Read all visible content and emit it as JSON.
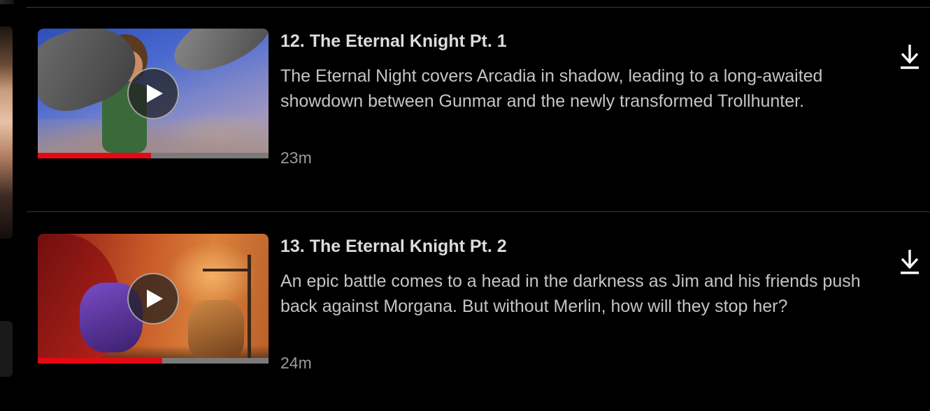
{
  "episodes": [
    {
      "title": "12. The Eternal Knight Pt. 1",
      "description": "The Eternal Night covers Arcadia in shadow, leading to a long-awaited showdown between Gunmar and the newly transformed Trollhunter.",
      "duration": "23m",
      "watched_fraction": 0.49,
      "icons": {
        "play": "play-icon",
        "download": "download-icon"
      }
    },
    {
      "title": "13. The Eternal Knight Pt. 2",
      "description": "An epic battle comes to a head in the darkness as Jim and his friends push back against Morgana. But without Merlin, how will they stop her?",
      "duration": "24m",
      "watched_fraction": 0.54,
      "icons": {
        "play": "play-icon",
        "download": "download-icon"
      }
    }
  ],
  "colors": {
    "background": "#000000",
    "progress_fill": "#e50914",
    "progress_track": "#7a7a7a",
    "title_text": "#dcdcdc",
    "description_text": "#c4c4c4",
    "duration_text": "#9a9a9a"
  }
}
